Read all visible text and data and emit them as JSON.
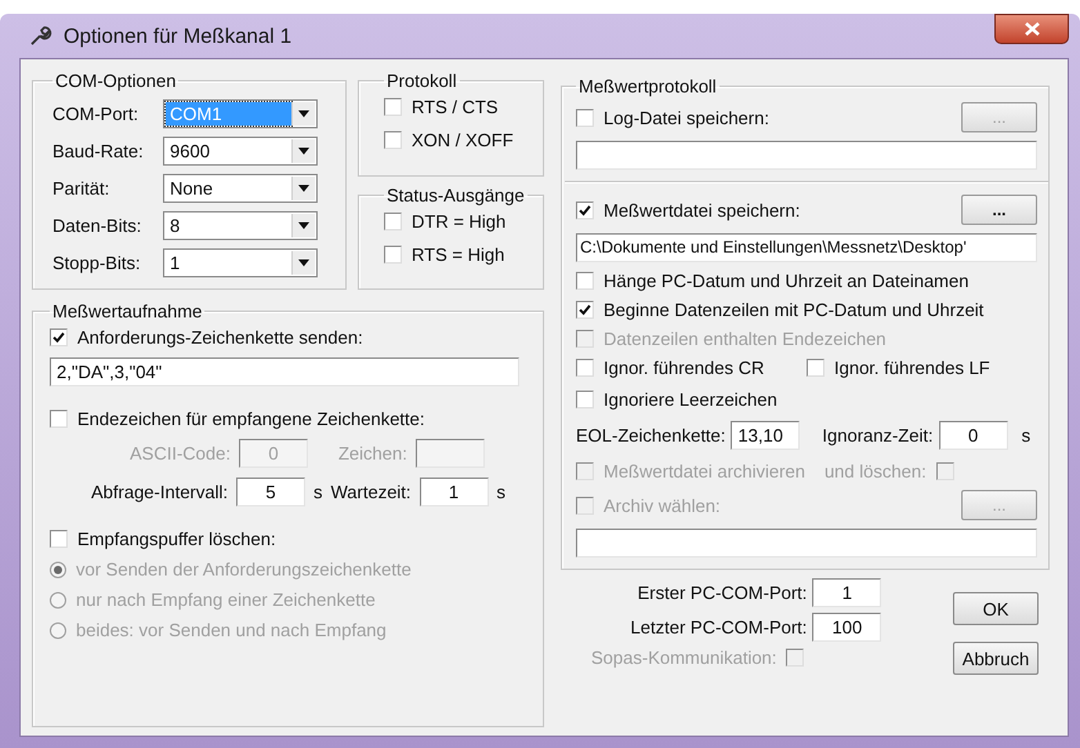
{
  "window": {
    "title": "Optionen für Meßkanal 1"
  },
  "com_options": {
    "title": "COM-Optionen",
    "fields": [
      {
        "label": "COM-Port:",
        "value": "COM1",
        "focused": true
      },
      {
        "label": "Baud-Rate:",
        "value": "9600",
        "focused": false
      },
      {
        "label": "Parität:",
        "value": "None",
        "focused": false
      },
      {
        "label": "Daten-Bits:",
        "value": "8",
        "focused": false
      },
      {
        "label": "Stopp-Bits:",
        "value": "1",
        "focused": false
      }
    ]
  },
  "protocol": {
    "title": "Protokoll",
    "checkboxes": [
      {
        "label": "RTS / CTS",
        "checked": false
      },
      {
        "label": "XON / XOFF",
        "checked": false
      }
    ]
  },
  "status_outputs": {
    "title": "Status-Ausgänge",
    "checkboxes": [
      {
        "label": "DTR = High",
        "checked": false
      },
      {
        "label": "RTS = High",
        "checked": false
      }
    ]
  },
  "acquisition": {
    "title": "Meßwertaufnahme",
    "send_request": {
      "label": "Anforderungs-Zeichenkette senden:",
      "checked": true
    },
    "request_string": "2,\"DA\",3,\"04\"",
    "end_char": {
      "label": "Endezeichen für empfangene Zeichenkette:",
      "checked": false
    },
    "ascii_code": {
      "label": "ASCII-Code:",
      "value": "0",
      "disabled": true
    },
    "char_field": {
      "label": "Zeichen:",
      "disabled": true
    },
    "interval": {
      "label": "Abfrage-Intervall:",
      "value": "5",
      "unit": "s"
    },
    "wait": {
      "label": "Wartezeit:",
      "value": "1",
      "unit": "s"
    },
    "clear_buffer": {
      "label": "Empfangspuffer löschen:",
      "checked": false
    },
    "radios": [
      {
        "label": "vor Senden der Anforderungszeichenkette",
        "selected": true,
        "disabled": true
      },
      {
        "label": "nur nach Empfang einer Zeichenkette",
        "selected": false,
        "disabled": true
      },
      {
        "label": "beides: vor Senden und nach Empfang",
        "selected": false,
        "disabled": true
      }
    ]
  },
  "measurement_log": {
    "title": "Meßwertprotokoll",
    "log_file": {
      "label": "Log-Datei speichern:",
      "checked": false,
      "button": "...",
      "button_disabled": true
    },
    "data_file": {
      "label": "Meßwertdatei speichern:",
      "checked": true,
      "button": "...",
      "button_disabled": false,
      "path": "C:\\Dokumente und Einstellungen\\Messnetz\\Desktop'"
    },
    "options": [
      {
        "label": "Hänge PC-Datum und Uhrzeit an Dateinamen",
        "checked": false,
        "disabled": false
      },
      {
        "label": "Beginne Datenzeilen mit PC-Datum und Uhrzeit",
        "checked": true,
        "disabled": false
      },
      {
        "label": "Datenzeilen enthalten Endezeichen",
        "checked": false,
        "disabled": true
      }
    ],
    "ignore_pair": [
      {
        "label": "Ignor. führendes CR",
        "checked": false
      },
      {
        "label": "Ignor. führendes LF",
        "checked": false
      }
    ],
    "ignore_spaces": {
      "label": "Ignoriere Leerzeichen",
      "checked": false
    },
    "eol": {
      "label": "EOL-Zeichenkette:",
      "value": "13,10"
    },
    "ignore_time": {
      "label": "Ignoranz-Zeit:",
      "value": "0",
      "unit": "s"
    },
    "archive": {
      "label": "Meßwertdatei archivieren",
      "checked": false,
      "disabled": true
    },
    "delete": {
      "label": "und löschen:",
      "checked": false,
      "disabled": true
    },
    "choose_archive": {
      "label": "Archiv wählen:",
      "checked": false,
      "disabled": true,
      "button": "...",
      "button_disabled": true
    }
  },
  "ports": {
    "first": {
      "label": "Erster PC-COM-Port:",
      "value": "1"
    },
    "last": {
      "label": "Letzter PC-COM-Port:",
      "value": "100"
    },
    "sopas": {
      "label": "Sopas-Kommunikation:",
      "checked": false,
      "disabled": true
    }
  },
  "buttons": [
    {
      "label": "OK"
    },
    {
      "label": "Abbruch"
    }
  ]
}
